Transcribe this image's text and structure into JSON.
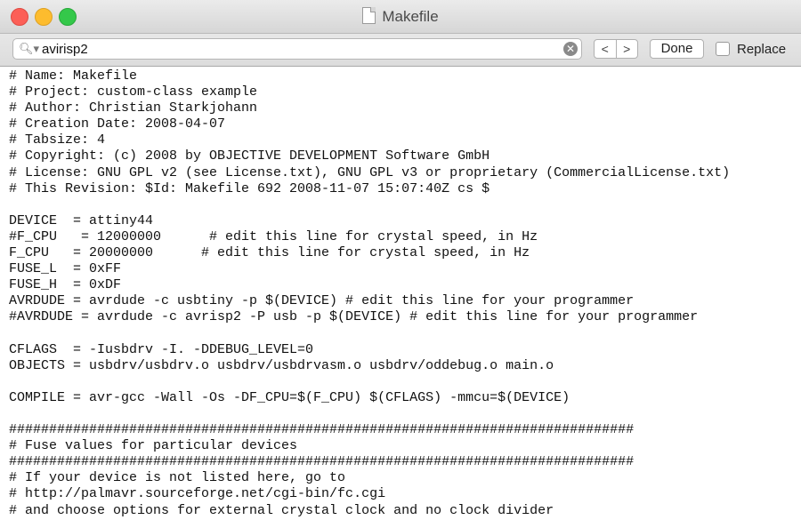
{
  "window": {
    "title": "Makefile"
  },
  "findbar": {
    "search_value": "avirisp2",
    "search_icon": "search-icon",
    "clear_icon": "clear-icon",
    "prev_label": "<",
    "next_label": ">",
    "done_label": "Done",
    "replace_label": "Replace"
  },
  "editor": {
    "lines": [
      "# Name: Makefile",
      "# Project: custom-class example",
      "# Author: Christian Starkjohann",
      "# Creation Date: 2008-04-07",
      "# Tabsize: 4",
      "# Copyright: (c) 2008 by OBJECTIVE DEVELOPMENT Software GmbH",
      "# License: GNU GPL v2 (see License.txt), GNU GPL v3 or proprietary (CommercialLicense.txt)",
      "# This Revision: $Id: Makefile 692 2008-11-07 15:07:40Z cs $",
      "",
      "DEVICE  = attiny44",
      "#F_CPU   = 12000000      # edit this line for crystal speed, in Hz",
      "F_CPU   = 20000000      # edit this line for crystal speed, in Hz",
      "FUSE_L  = 0xFF",
      "FUSE_H  = 0xDF",
      "AVRDUDE = avrdude -c usbtiny -p $(DEVICE) # edit this line for your programmer",
      "#AVRDUDE = avrdude -c avrisp2 -P usb -p $(DEVICE) # edit this line for your programmer",
      "",
      "CFLAGS  = -Iusbdrv -I. -DDEBUG_LEVEL=0",
      "OBJECTS = usbdrv/usbdrv.o usbdrv/usbdrvasm.o usbdrv/oddebug.o main.o",
      "",
      "COMPILE = avr-gcc -Wall -Os -DF_CPU=$(F_CPU) $(CFLAGS) -mmcu=$(DEVICE)",
      "",
      "##############################################################################",
      "# Fuse values for particular devices",
      "##############################################################################",
      "# If your device is not listed here, go to",
      "# http://palmavr.sourceforge.net/cgi-bin/fc.cgi",
      "# and choose options for external crystal clock and no clock divider"
    ]
  }
}
